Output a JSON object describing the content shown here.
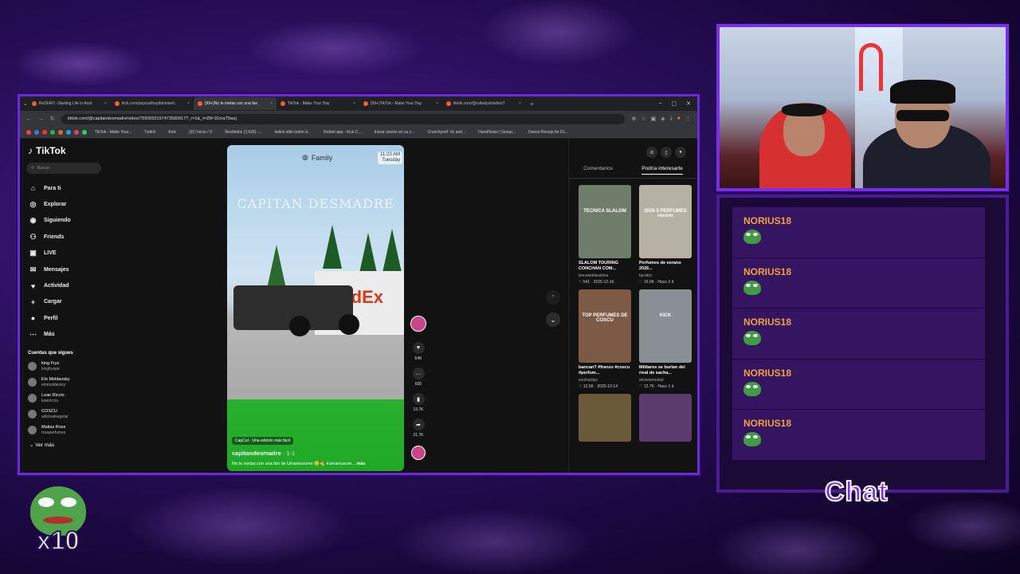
{
  "browser": {
    "tabs": [
      {
        "label": "ReZERO -Starting Life in Anot",
        "active": false
      },
      {
        "label": "kick.com/popout/hayddnoise/c",
        "active": false
      },
      {
        "label": "(99+)No te metas con una fan",
        "active": true
      },
      {
        "label": "TikTok - Make Your Day",
        "active": false
      },
      {
        "label": "(99+)TikTok - Make Your Day",
        "active": false
      },
      {
        "label": "tiktok.com/@cabalyst/video/7",
        "active": false
      }
    ],
    "url": "tiktok.com/@capitandesmadre/video/7590555157473580917?_r=1&_t=ZM-92zraT5wzj",
    "bookmarks": [
      "TikTok - Make Your...",
      "Twitch",
      "Kick",
      "(31) Inicio / X",
      "Recibidos (3,626) -...",
      "twitch sitio botón d...",
      "Kicklet.app - Kick C...",
      "Iniciar sesión en su c...",
      "Crunchyroll: Ve anó...",
      "HandNoise | Group...",
      "Dance Revojo for Di..."
    ]
  },
  "tiktok": {
    "logo": "TikTok",
    "search_placeholder": "Buscar",
    "nav": [
      {
        "label": "Para ti",
        "icon": "home-icon",
        "glyph": "⌂"
      },
      {
        "label": "Explorar",
        "icon": "compass-icon",
        "glyph": "◎"
      },
      {
        "label": "Siguiendo",
        "icon": "following-icon",
        "glyph": "◉"
      },
      {
        "label": "Friends",
        "icon": "friends-icon",
        "glyph": "⚇"
      },
      {
        "label": "LIVE",
        "icon": "live-icon",
        "glyph": "▣"
      },
      {
        "label": "Mensajes",
        "icon": "messages-icon",
        "glyph": "✉"
      },
      {
        "label": "Actividad",
        "icon": "activity-icon",
        "glyph": "♥"
      },
      {
        "label": "Cargar",
        "icon": "upload-icon",
        "glyph": "+"
      },
      {
        "label": "Perfil",
        "icon": "profile-icon",
        "glyph": "●"
      },
      {
        "label": "Más",
        "icon": "more-icon",
        "glyph": "⋯"
      }
    ],
    "following_title": "Cuentas que sigues",
    "following": [
      {
        "name": "king Frys",
        "handle": "kingfryspe"
      },
      {
        "name": "Elo Moldavsky",
        "handle": "elomoldavsky"
      },
      {
        "name": "Lean Riccio",
        "handle": "leanriccio"
      },
      {
        "name": "COSCU",
        "handle": "adictoalvegetal"
      },
      {
        "name": "Matias Ross",
        "handle": "rossperfumes"
      }
    ],
    "see_more": "Ver más",
    "video": {
      "family_label": "Family",
      "time": "11:23 AM",
      "day": "Tuesday",
      "watermark": "CAPITAN DESMADRE",
      "truck_brand": "FedEx",
      "capcut": "CapCut · Una edición más fácil",
      "author": "capitandesmadre",
      "author_suffix": "· 1-1",
      "description": "No te metas con una fan de Umamusume 😊🐴 #umamusum...",
      "more": "más"
    },
    "actions": [
      {
        "icon": "like-icon",
        "glyph": "♥",
        "count": "64K"
      },
      {
        "icon": "comment-icon",
        "glyph": "…",
        "count": "605"
      },
      {
        "icon": "bookmark-icon",
        "glyph": "▮",
        "count": "13.7K"
      },
      {
        "icon": "share-icon",
        "glyph": "➦",
        "count": "21.7K"
      }
    ],
    "right_tabs": [
      "Comentarios",
      "Podría interesarte"
    ],
    "cards": [
      {
        "title": "SLALOM TOURING CONCHAN COM...",
        "user": "brevetebikeslima",
        "likes": "541",
        "date": "2025-12-16",
        "thumb_color": "#6f7d6a",
        "thumb_label": "TECNICA SLALOM"
      },
      {
        "title": "Perfumes de verano 2026...",
        "user": "farodric",
        "likes": "16.6K",
        "date": "Hace 2 d",
        "thumb_color": "#b5b1a3",
        "thumb_label": "2026 3 PERFUMES verano"
      },
      {
        "title": "bancan? #franzo #coscu #perfum...",
        "user": "zonfraclips",
        "likes": "12.5K",
        "date": "2025-12-14",
        "thumb_color": "#7d5a45",
        "thumb_label": "TOP PERFUMES DE COSCU"
      },
      {
        "title": "Militares se burlan del rival de sacha...",
        "user": "showseroviral",
        "likes": "12.7K",
        "date": "Hace 1 d",
        "thumb_color": "#8a8f96",
        "thumb_label": "KICK"
      },
      {
        "title": "",
        "user": "",
        "likes": "",
        "date": "",
        "thumb_color": "#6a5a3a",
        "thumb_label": ""
      },
      {
        "title": "",
        "user": "",
        "likes": "",
        "date": "",
        "thumb_color": "#5b3a6e",
        "thumb_label": ""
      }
    ]
  },
  "chat": {
    "messages": [
      {
        "user": "NORIUS18",
        "emote": "pepe-emote"
      },
      {
        "user": "NORIUS18",
        "emote": "pepe-emote"
      },
      {
        "user": "NORIUS18",
        "emote": "pepe-emote"
      },
      {
        "user": "NORIUS18",
        "emote": "pepe-emote"
      },
      {
        "user": "NORIUS18",
        "emote": "pepe-emote"
      }
    ],
    "label": "Chat"
  },
  "badge": {
    "multiplier": "x10"
  },
  "colors": {
    "accent": "#7a2cf0",
    "chat_username": "#f0a23c",
    "background": "#2a0f5c"
  }
}
